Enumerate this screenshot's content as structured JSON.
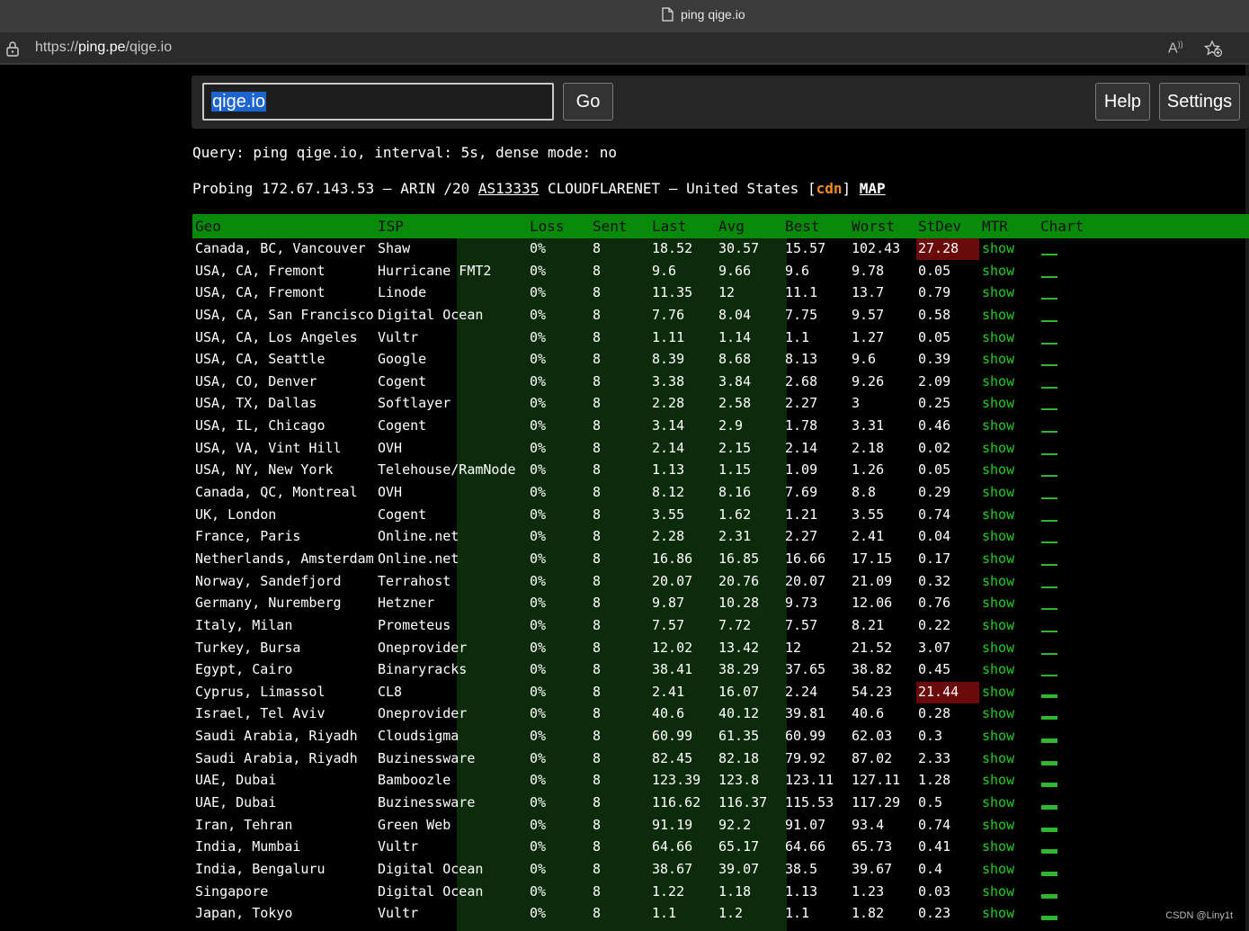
{
  "browser": {
    "tab_title": "ping qige.io",
    "url_prefix": "https://",
    "url_host": "ping.pe",
    "url_path": "/qige.io"
  },
  "toolbar": {
    "search_value": "qige.io",
    "go_label": "Go",
    "help_label": "Help",
    "settings_label": "Settings"
  },
  "info": {
    "query": "Query: ping qige.io, interval: 5s, dense mode: no",
    "probe_prefix": "Probing 172.67.143.53 — ARIN /20 ",
    "asn": "AS13335",
    "probe_mid": " CLOUDFLARENET — United States [",
    "cdn": "cdn",
    "probe_end": "] ",
    "map": "MAP"
  },
  "table": {
    "headers": [
      "Geo",
      "ISP",
      "Loss",
      "Sent",
      "Last",
      "Avg",
      "Best",
      "Worst",
      "StDev",
      "MTR",
      "Chart"
    ],
    "rows": [
      {
        "geo": "Canada, BC, Vancouver",
        "isp": "Shaw",
        "loss": "0%",
        "sent": "8",
        "last": "18.52",
        "avg": "30.57",
        "best": "15.57",
        "worst": "102.43",
        "stdev": "27.28",
        "mtr": "show",
        "high": true,
        "spark": 18
      },
      {
        "geo": "USA, CA, Fremont",
        "isp": "Hurricane FMT2",
        "loss": "0%",
        "sent": "8",
        "last": "9.6",
        "avg": "9.66",
        "best": "9.6",
        "worst": "9.78",
        "stdev": "0.05",
        "mtr": "show",
        "high": false,
        "spark": 18
      },
      {
        "geo": "USA, CA, Fremont",
        "isp": "Linode",
        "loss": "0%",
        "sent": "8",
        "last": "11.35",
        "avg": "12",
        "best": "11.1",
        "worst": "13.7",
        "stdev": "0.79",
        "mtr": "show",
        "high": false,
        "spark": 18
      },
      {
        "geo": "USA, CA, San Francisco",
        "isp": "Digital Ocean",
        "loss": "0%",
        "sent": "8",
        "last": "7.76",
        "avg": "8.04",
        "best": "7.75",
        "worst": "9.57",
        "stdev": "0.58",
        "mtr": "show",
        "high": false,
        "spark": 18
      },
      {
        "geo": "USA, CA, Los Angeles",
        "isp": "Vultr",
        "loss": "0%",
        "sent": "8",
        "last": "1.11",
        "avg": "1.14",
        "best": "1.1",
        "worst": "1.27",
        "stdev": "0.05",
        "mtr": "show",
        "high": false,
        "spark": 18
      },
      {
        "geo": "USA, CA, Seattle",
        "isp": "Google",
        "loss": "0%",
        "sent": "8",
        "last": "8.39",
        "avg": "8.68",
        "best": "8.13",
        "worst": "9.6",
        "stdev": "0.39",
        "mtr": "show",
        "high": false,
        "spark": 18
      },
      {
        "geo": "USA, CO, Denver",
        "isp": "Cogent",
        "loss": "0%",
        "sent": "8",
        "last": "3.38",
        "avg": "3.84",
        "best": "2.68",
        "worst": "9.26",
        "stdev": "2.09",
        "mtr": "show",
        "high": false,
        "spark": 18
      },
      {
        "geo": "USA, TX, Dallas",
        "isp": "Softlayer",
        "loss": "0%",
        "sent": "8",
        "last": "2.28",
        "avg": "2.58",
        "best": "2.27",
        "worst": "3",
        "stdev": "0.25",
        "mtr": "show",
        "high": false,
        "spark": 18
      },
      {
        "geo": "USA, IL, Chicago",
        "isp": "Cogent",
        "loss": "0%",
        "sent": "8",
        "last": "3.14",
        "avg": "2.9",
        "best": "1.78",
        "worst": "3.31",
        "stdev": "0.46",
        "mtr": "show",
        "high": false,
        "spark": 18
      },
      {
        "geo": "USA, VA, Vint Hill",
        "isp": "OVH",
        "loss": "0%",
        "sent": "8",
        "last": "2.14",
        "avg": "2.15",
        "best": "2.14",
        "worst": "2.18",
        "stdev": "0.02",
        "mtr": "show",
        "high": false,
        "spark": 18
      },
      {
        "geo": "USA, NY, New York",
        "isp": "Telehouse/RamNode",
        "loss": "0%",
        "sent": "8",
        "last": "1.13",
        "avg": "1.15",
        "best": "1.09",
        "worst": "1.26",
        "stdev": "0.05",
        "mtr": "show",
        "high": false,
        "spark": 18
      },
      {
        "geo": "Canada, QC, Montreal",
        "isp": "OVH",
        "loss": "0%",
        "sent": "8",
        "last": "8.12",
        "avg": "8.16",
        "best": "7.69",
        "worst": "8.8",
        "stdev": "0.29",
        "mtr": "show",
        "high": false,
        "spark": 18
      },
      {
        "geo": "UK, London",
        "isp": "Cogent",
        "loss": "0%",
        "sent": "8",
        "last": "3.55",
        "avg": "1.62",
        "best": "1.21",
        "worst": "3.55",
        "stdev": "0.74",
        "mtr": "show",
        "high": false,
        "spark": 18
      },
      {
        "geo": "France, Paris",
        "isp": "Online.net",
        "loss": "0%",
        "sent": "8",
        "last": "2.28",
        "avg": "2.31",
        "best": "2.27",
        "worst": "2.41",
        "stdev": "0.04",
        "mtr": "show",
        "high": false,
        "spark": 18
      },
      {
        "geo": "Netherlands, Amsterdam",
        "isp": "Online.net",
        "loss": "0%",
        "sent": "8",
        "last": "16.86",
        "avg": "16.85",
        "best": "16.66",
        "worst": "17.15",
        "stdev": "0.17",
        "mtr": "show",
        "high": false,
        "spark": 18
      },
      {
        "geo": "Norway, Sandefjord",
        "isp": "Terrahost",
        "loss": "0%",
        "sent": "8",
        "last": "20.07",
        "avg": "20.76",
        "best": "20.07",
        "worst": "21.09",
        "stdev": "0.32",
        "mtr": "show",
        "high": false,
        "spark": 18
      },
      {
        "geo": "Germany, Nuremberg",
        "isp": "Hetzner",
        "loss": "0%",
        "sent": "8",
        "last": "9.87",
        "avg": "10.28",
        "best": "9.73",
        "worst": "12.06",
        "stdev": "0.76",
        "mtr": "show",
        "high": false,
        "spark": 18
      },
      {
        "geo": "Italy, Milan",
        "isp": "Prometeus",
        "loss": "0%",
        "sent": "8",
        "last": "7.57",
        "avg": "7.72",
        "best": "7.57",
        "worst": "8.21",
        "stdev": "0.22",
        "mtr": "show",
        "high": false,
        "spark": 18
      },
      {
        "geo": "Turkey, Bursa",
        "isp": "Oneprovider",
        "loss": "0%",
        "sent": "8",
        "last": "12.02",
        "avg": "13.42",
        "best": "12",
        "worst": "21.52",
        "stdev": "3.07",
        "mtr": "show",
        "high": false,
        "spark": 18
      },
      {
        "geo": "Egypt, Cairo",
        "isp": "Binaryracks",
        "loss": "0%",
        "sent": "8",
        "last": "38.41",
        "avg": "38.29",
        "best": "37.65",
        "worst": "38.82",
        "stdev": "0.45",
        "mtr": "show",
        "high": false,
        "spark": 18
      },
      {
        "geo": "Cyprus, Limassol",
        "isp": "CL8",
        "loss": "0%",
        "sent": "8",
        "last": "2.41",
        "avg": "16.07",
        "best": "2.24",
        "worst": "54.23",
        "stdev": "21.44",
        "mtr": "show",
        "high": true,
        "spark": 18
      },
      {
        "geo": "Israel, Tel Aviv",
        "isp": "Oneprovider",
        "loss": "0%",
        "sent": "8",
        "last": "40.6",
        "avg": "40.12",
        "best": "39.81",
        "worst": "40.6",
        "stdev": "0.28",
        "mtr": "show",
        "high": false,
        "spark": 18
      },
      {
        "geo": "Saudi Arabia, Riyadh",
        "isp": "Cloudsigma",
        "loss": "0%",
        "sent": "8",
        "last": "60.99",
        "avg": "61.35",
        "best": "60.99",
        "worst": "62.03",
        "stdev": "0.3",
        "mtr": "show",
        "high": false,
        "spark": 18
      },
      {
        "geo": "Saudi Arabia, Riyadh",
        "isp": "Buzinessware",
        "loss": "0%",
        "sent": "8",
        "last": "82.45",
        "avg": "82.18",
        "best": "79.92",
        "worst": "87.02",
        "stdev": "2.33",
        "mtr": "show",
        "high": false,
        "spark": 18
      },
      {
        "geo": "UAE, Dubai",
        "isp": "Bamboozle",
        "loss": "0%",
        "sent": "8",
        "last": "123.39",
        "avg": "123.8",
        "best": "123.11",
        "worst": "127.11",
        "stdev": "1.28",
        "mtr": "show",
        "high": false,
        "spark": 18
      },
      {
        "geo": "UAE, Dubai",
        "isp": "Buzinessware",
        "loss": "0%",
        "sent": "8",
        "last": "116.62",
        "avg": "116.37",
        "best": "115.53",
        "worst": "117.29",
        "stdev": "0.5",
        "mtr": "show",
        "high": false,
        "spark": 18
      },
      {
        "geo": "Iran, Tehran",
        "isp": "Green Web",
        "loss": "0%",
        "sent": "8",
        "last": "91.19",
        "avg": "92.2",
        "best": "91.07",
        "worst": "93.4",
        "stdev": "0.74",
        "mtr": "show",
        "high": false,
        "spark": 18
      },
      {
        "geo": "India, Mumbai",
        "isp": "Vultr",
        "loss": "0%",
        "sent": "8",
        "last": "64.66",
        "avg": "65.17",
        "best": "64.66",
        "worst": "65.73",
        "stdev": "0.41",
        "mtr": "show",
        "high": false,
        "spark": 18
      },
      {
        "geo": "India, Bengaluru",
        "isp": "Digital Ocean",
        "loss": "0%",
        "sent": "8",
        "last": "38.67",
        "avg": "39.07",
        "best": "38.5",
        "worst": "39.67",
        "stdev": "0.4",
        "mtr": "show",
        "high": false,
        "spark": 18
      },
      {
        "geo": "Singapore",
        "isp": "Digital Ocean",
        "loss": "0%",
        "sent": "8",
        "last": "1.22",
        "avg": "1.18",
        "best": "1.13",
        "worst": "1.23",
        "stdev": "0.03",
        "mtr": "show",
        "high": false,
        "spark": 18
      },
      {
        "geo": "Japan, Tokyo",
        "isp": "Vultr",
        "loss": "0%",
        "sent": "8",
        "last": "1.1",
        "avg": "1.2",
        "best": "1.1",
        "worst": "1.82",
        "stdev": "0.23",
        "mtr": "show",
        "high": false,
        "spark": 18
      }
    ]
  },
  "watermark": "CSDN @Liny1t",
  "colors": {
    "header_green": "#0a8a0a",
    "mtr_link": "#22cc22",
    "stdev_high": "#6b0a0a",
    "cdn_orange": "#f08a24"
  }
}
